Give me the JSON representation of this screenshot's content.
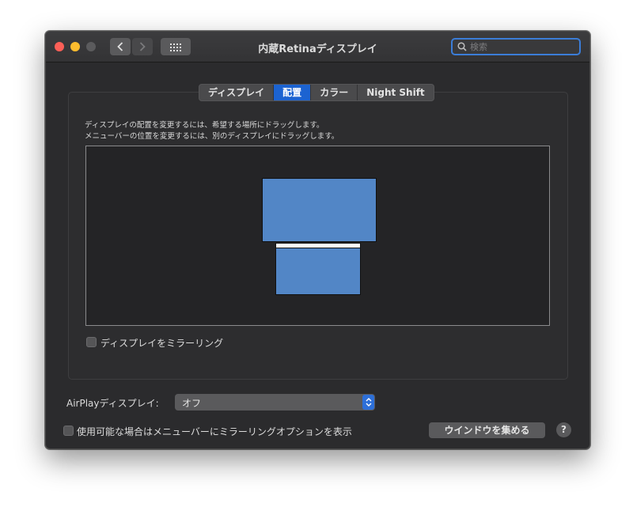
{
  "window": {
    "title": "内蔵Retinaディスプレイ"
  },
  "toolbar": {
    "back_icon": "chevron-left-icon",
    "forward_icon": "chevron-right-icon",
    "grid_icon": "grid-icon"
  },
  "search": {
    "placeholder": "検索",
    "value": "",
    "icon": "search-icon"
  },
  "tabs": [
    {
      "label": "ディスプレイ",
      "active": false
    },
    {
      "label": "配置",
      "active": true
    },
    {
      "label": "カラー",
      "active": false
    },
    {
      "label": "Night Shift",
      "active": false
    }
  ],
  "arrangement": {
    "instruction_line1": "ディスプレイの配置を変更するには、希望する場所にドラッグします。",
    "instruction_line2": "メニューバーの位置を変更するには、別のディスプレイにドラッグします。",
    "display_color": "#5286c6"
  },
  "mirror": {
    "label": "ディスプレイをミラーリング",
    "checked": false
  },
  "airplay": {
    "label": "AirPlayディスプレイ:",
    "value": "オフ"
  },
  "menubar_option": {
    "label": "使用可能な場合はメニューバーにミラーリングオプションを表示",
    "checked": false
  },
  "buttons": {
    "gather_windows": "ウインドウを集める",
    "help": "?"
  },
  "colors": {
    "accent": "#1c63d1",
    "close": "#fc5f57",
    "minimize": "#fdbc2e"
  }
}
